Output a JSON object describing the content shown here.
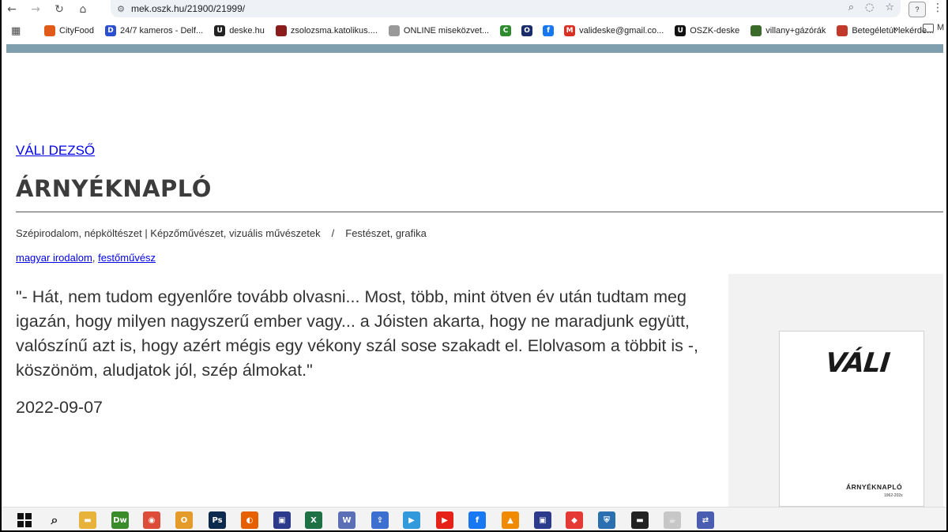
{
  "browser": {
    "url": "mek.oszk.hu/21900/21999/",
    "profile_badge": "?",
    "nav": {
      "back": "←",
      "forward": "→",
      "reload": "↻",
      "home": "⌂"
    }
  },
  "bookmarks": {
    "items": [
      {
        "label": "CityFood",
        "icon": "cityfood-icon",
        "color": "#e05a1a",
        "glyph": ""
      },
      {
        "label": "24/7 kameros - Delf...",
        "icon": "delfi-icon",
        "color": "#2b4fd0",
        "glyph": "D"
      },
      {
        "label": "deske.hu",
        "icon": "deske-icon",
        "color": "#222222",
        "glyph": "U"
      },
      {
        "label": "zsolozsma.katolikus....",
        "icon": "zsolozsma-icon",
        "color": "#8b1c1c",
        "glyph": ""
      },
      {
        "label": "ONLINE miseközvet...",
        "icon": "mise-icon",
        "color": "#999999",
        "glyph": ""
      },
      {
        "label": "",
        "icon": "green-circle-icon",
        "color": "#2e8b2e",
        "glyph": "C"
      },
      {
        "label": "",
        "icon": "o-icon",
        "color": "#1a2b6b",
        "glyph": "O"
      },
      {
        "label": "",
        "icon": "facebook-icon",
        "color": "#1877f2",
        "glyph": "f"
      },
      {
        "label": "valideske@gmail.co...",
        "icon": "gmail-icon",
        "color": "#d93025",
        "glyph": "M"
      },
      {
        "label": "OSZK-deske",
        "icon": "oszk-icon",
        "color": "#111111",
        "glyph": "U"
      },
      {
        "label": "villany+gázórák",
        "icon": "villany-icon",
        "color": "#3a6b2a",
        "glyph": ""
      },
      {
        "label": "Betegéletút lekérde...",
        "icon": "beteg-icon",
        "color": "#c0392b",
        "glyph": ""
      }
    ],
    "more": "»",
    "folder_label": "M"
  },
  "page": {
    "author": "VÁLI DEZSŐ",
    "title": "ÁRNYÉKNAPLÓ",
    "categories": {
      "left": "Szépirodalom, népköltészet | Képzőművészet, vizuális művészetek",
      "separator": "/",
      "right": "Festészet, grafika"
    },
    "tags": [
      {
        "label": "magyar irodalom"
      },
      {
        "label": "festőművész"
      }
    ],
    "tag_separator": ",",
    "quote": "\"- Hát, nem tudom egyenlőre tovább olvasni... Most, több, mint ötven év után tudtam meg igazán, hogy milyen nagyszerű ember vagy... a Jóisten akarta, hogy ne maradjunk együtt, valószínű azt is, hogy azért mégis egy vékony szál sose szakadt el. Elolvasom a többit is -, köszönöm, aludjatok jól, szép álmokat.\"",
    "date": "2022-09-07",
    "cover": {
      "author": "VÁLI",
      "title": "ÁRNYÉKNAPLÓ",
      "years": "1962-202x"
    }
  },
  "colors": {
    "link": "#0000ee",
    "site_strip": "#7f9fae",
    "title_text": "#3c3c3c"
  },
  "taskbar": {
    "icons": [
      {
        "name": "windows-start-icon",
        "glyph": "",
        "color": ""
      },
      {
        "name": "search-icon",
        "glyph": "⌕",
        "color": ""
      },
      {
        "name": "file-explorer-icon",
        "glyph": "▬",
        "color": "#e8b33a"
      },
      {
        "name": "dreamweaver-icon",
        "glyph": "Dw",
        "color": "#3a8b2a"
      },
      {
        "name": "chrome-icon",
        "glyph": "◉",
        "color": "#dd4b39"
      },
      {
        "name": "outlook-icon",
        "glyph": "O",
        "color": "#e59b2a"
      },
      {
        "name": "photoshop-icon",
        "glyph": "Ps",
        "color": "#0c2a4d"
      },
      {
        "name": "firefox-icon",
        "glyph": "◐",
        "color": "#e66000"
      },
      {
        "name": "save-app-icon",
        "glyph": "▣",
        "color": "#2b3a8b"
      },
      {
        "name": "excel-icon",
        "glyph": "X",
        "color": "#1e7145"
      },
      {
        "name": "word-app-icon",
        "glyph": "W",
        "color": "#5a6fb5"
      },
      {
        "name": "upload-app-icon",
        "glyph": "⇪",
        "color": "#3b6fd0"
      },
      {
        "name": "media-app-icon",
        "glyph": "▶",
        "color": "#3399dd"
      },
      {
        "name": "youtube-icon",
        "glyph": "▶",
        "color": "#e62117"
      },
      {
        "name": "facebook-taskbar-icon",
        "glyph": "f",
        "color": "#1877f2"
      },
      {
        "name": "vlc-icon",
        "glyph": "▲",
        "color": "#f08a00"
      },
      {
        "name": "floppy-icon",
        "glyph": "▣",
        "color": "#2b3a8b"
      },
      {
        "name": "anydesk-icon",
        "glyph": "◆",
        "color": "#e53935"
      },
      {
        "name": "shield-app-icon",
        "glyph": "⛨",
        "color": "#2a6fb0"
      },
      {
        "name": "terminal-icon",
        "glyph": "▬",
        "color": "#222222"
      },
      {
        "name": "java-icon",
        "glyph": "☕",
        "color": "#c7c7c7"
      },
      {
        "name": "network-app-icon",
        "glyph": "⇄",
        "color": "#4a5db0"
      }
    ]
  }
}
